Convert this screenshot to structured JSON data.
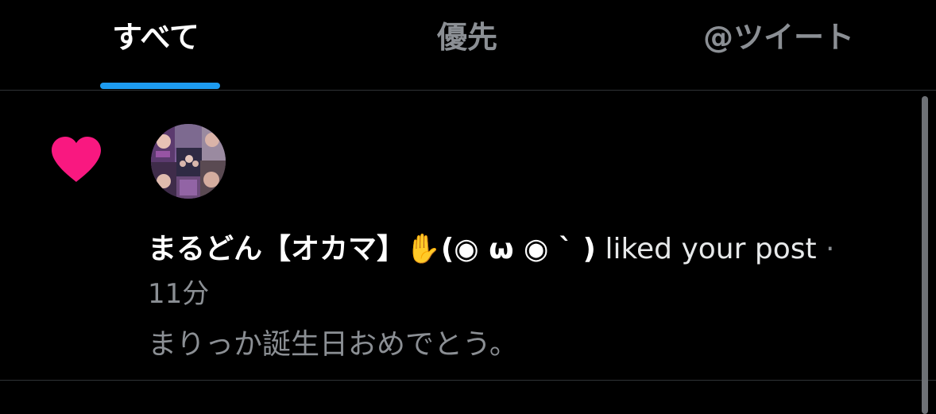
{
  "tabs": [
    {
      "label": "すべて",
      "selected": true
    },
    {
      "label": "優先",
      "selected": false
    },
    {
      "label": "@ツイート",
      "selected": false
    }
  ],
  "notification": {
    "type_icon": "heart-icon",
    "icon_color": "#f91880",
    "user_name": "まるどん【オカマ】✋(◉ ω ◉ ` )",
    "action": "liked your post",
    "separator": "·",
    "time": "11分",
    "post_text": "まりっか誕生日おめでとう。"
  },
  "colors": {
    "accent": "#1d9bf0",
    "background": "#000000",
    "secondary_text": "#8b8f94"
  }
}
